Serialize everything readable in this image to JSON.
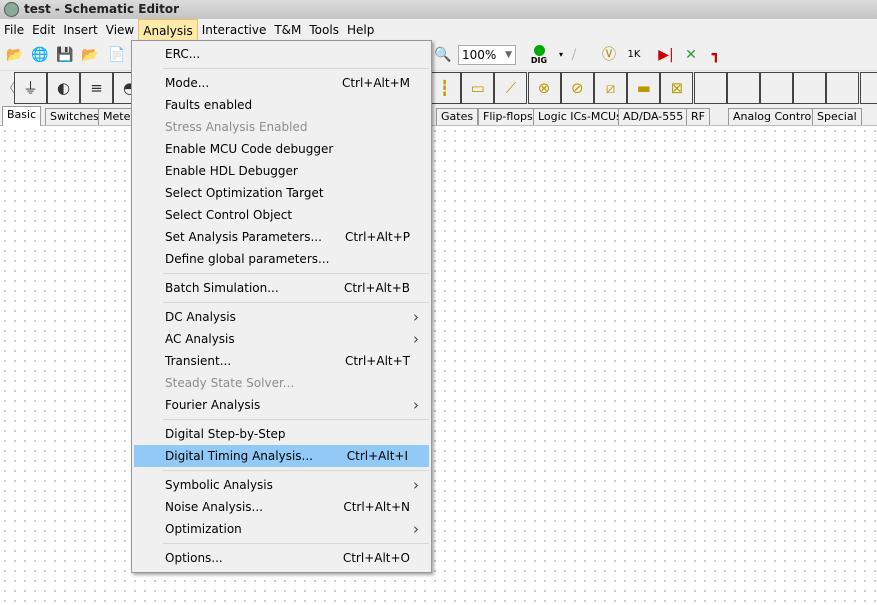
{
  "window": {
    "title": "test - Schematic Editor"
  },
  "menubar": [
    "File",
    "Edit",
    "Insert",
    "View",
    "Analysis",
    "Interactive",
    "T&M",
    "Tools",
    "Help"
  ],
  "active_menu": "Analysis",
  "toolbar": {
    "zoom_value": "100%",
    "dig_label": "DIG"
  },
  "component_tabs": [
    "Basic",
    "Switches",
    "Meters",
    "Gates",
    "Flip-flops",
    "Logic ICs-MCUs",
    "AD/DA-555",
    "RF",
    "Analog Control",
    "Special"
  ],
  "selected_tab": "Basic",
  "analysis_menu": [
    {
      "label": "ERC..."
    },
    {
      "sep": true
    },
    {
      "label": "Mode...",
      "shortcut": "Ctrl+Alt+M"
    },
    {
      "label": "Faults enabled"
    },
    {
      "label": "Stress Analysis Enabled",
      "disabled": true
    },
    {
      "label": "Enable MCU Code debugger"
    },
    {
      "label": "Enable HDL Debugger"
    },
    {
      "label": "Select Optimization Target"
    },
    {
      "label": "Select Control Object"
    },
    {
      "label": "Set Analysis Parameters...",
      "shortcut": "Ctrl+Alt+P"
    },
    {
      "label": "Define global parameters..."
    },
    {
      "sep": true
    },
    {
      "label": "Batch Simulation...",
      "shortcut": "Ctrl+Alt+B"
    },
    {
      "sep": true
    },
    {
      "label": "DC Analysis",
      "submenu": true
    },
    {
      "label": "AC Analysis",
      "submenu": true
    },
    {
      "label": "Transient...",
      "shortcut": "Ctrl+Alt+T"
    },
    {
      "label": "Steady State Solver...",
      "disabled": true
    },
    {
      "label": "Fourier Analysis",
      "submenu": true
    },
    {
      "sep": true
    },
    {
      "label": "Digital Step-by-Step"
    },
    {
      "label": "Digital Timing Analysis...",
      "shortcut": "Ctrl+Alt+I",
      "highlighted": true
    },
    {
      "sep": true
    },
    {
      "label": "Symbolic Analysis",
      "submenu": true
    },
    {
      "label": "Noise Analysis...",
      "shortcut": "Ctrl+Alt+N"
    },
    {
      "label": "Optimization",
      "submenu": true
    },
    {
      "sep": true
    },
    {
      "label": "Options...",
      "shortcut": "Ctrl+Alt+O"
    }
  ],
  "colors": {
    "highlight": "#91c9f7",
    "menu_active": "#fde9a8"
  }
}
